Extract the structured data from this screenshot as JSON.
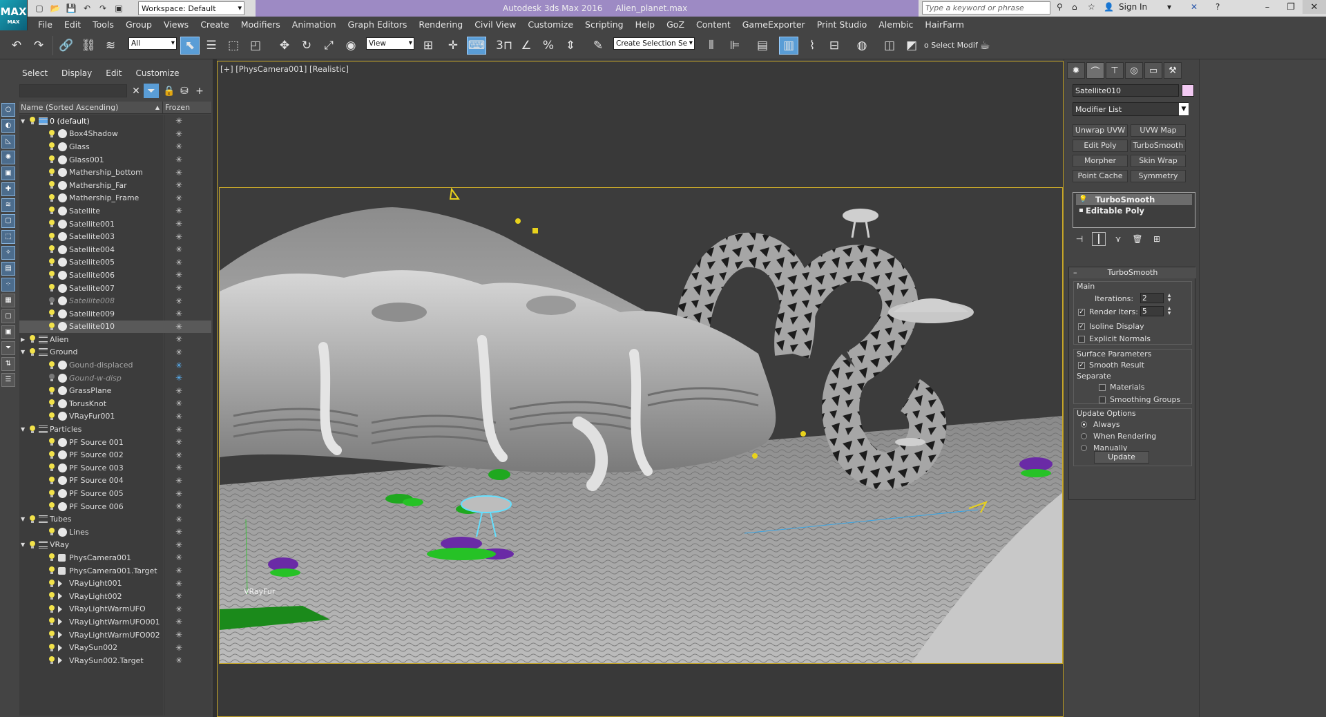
{
  "titlebar": {
    "logo": "MAX",
    "workspace": "Workspace: Default",
    "app_title": "Autodesk 3ds Max 2016     Alien_planet.max",
    "search_placeholder": "Type a keyword or phrase",
    "sign_in": "Sign In"
  },
  "menu": [
    "File",
    "Edit",
    "Tools",
    "Group",
    "Views",
    "Create",
    "Modifiers",
    "Animation",
    "Graph Editors",
    "Rendering",
    "Civil View",
    "Customize",
    "Scripting",
    "Help",
    "GoZ",
    "Content",
    "GameExporter",
    "Print Studio",
    "Alembic",
    "HairFarm"
  ],
  "toolbar": {
    "selection_filter": "All",
    "ref_coord": "View",
    "named_selection": "Create Selection Se",
    "select_modifier": "o Select Modif"
  },
  "explorer": {
    "tabs": [
      "Select",
      "Display",
      "Edit",
      "Customize"
    ],
    "col_name": "Name (Sorted Ascending)",
    "col_frozen": "Frozen",
    "rows": [
      {
        "label": "0 (default)",
        "type": "layer",
        "level": 0,
        "expanded": true,
        "state": "selected-layer"
      },
      {
        "label": "Box4Shadow",
        "type": "object",
        "level": 1
      },
      {
        "label": "Glass",
        "type": "object",
        "level": 1
      },
      {
        "label": "Glass001",
        "type": "object",
        "level": 1
      },
      {
        "label": "Mathership_bottom",
        "type": "object",
        "level": 1
      },
      {
        "label": "Mathership_Far",
        "type": "object",
        "level": 1
      },
      {
        "label": "Mathership_Frame",
        "type": "object",
        "level": 1
      },
      {
        "label": "Satellite",
        "type": "object",
        "level": 1
      },
      {
        "label": "Satellite001",
        "type": "object",
        "level": 1
      },
      {
        "label": "Satellite003",
        "type": "object",
        "level": 1
      },
      {
        "label": "Satellite004",
        "type": "object",
        "level": 1
      },
      {
        "label": "Satellite005",
        "type": "object",
        "level": 1
      },
      {
        "label": "Satellite006",
        "type": "object",
        "level": 1
      },
      {
        "label": "Satellite007",
        "type": "object",
        "level": 1
      },
      {
        "label": "Satellite008",
        "type": "object",
        "level": 1,
        "state": "hidden"
      },
      {
        "label": "Satellite009",
        "type": "object",
        "level": 1
      },
      {
        "label": "Satellite010",
        "type": "object",
        "level": 1,
        "state": "selected"
      },
      {
        "label": "Alien",
        "type": "layer",
        "level": 0,
        "expanded": false
      },
      {
        "label": "Ground",
        "type": "layer",
        "level": 0,
        "expanded": true
      },
      {
        "label": "Gound-displaced",
        "type": "object",
        "level": 1,
        "state": "frozen"
      },
      {
        "label": "Gound-w-disp",
        "type": "object",
        "level": 1,
        "state": "hidden-frozen"
      },
      {
        "label": "GrassPlane",
        "type": "object",
        "level": 1
      },
      {
        "label": "TorusKnot",
        "type": "object",
        "level": 1
      },
      {
        "label": "VRayFur001",
        "type": "object",
        "level": 1
      },
      {
        "label": "Particles",
        "type": "layer",
        "level": 0,
        "expanded": true
      },
      {
        "label": "PF Source 001",
        "type": "object",
        "level": 1
      },
      {
        "label": "PF Source 002",
        "type": "object",
        "level": 1
      },
      {
        "label": "PF Source 003",
        "type": "object",
        "level": 1
      },
      {
        "label": "PF Source 004",
        "type": "object",
        "level": 1
      },
      {
        "label": "PF Source 005",
        "type": "object",
        "level": 1
      },
      {
        "label": "PF Source 006",
        "type": "object",
        "level": 1
      },
      {
        "label": "Tubes",
        "type": "layer",
        "level": 0,
        "expanded": true
      },
      {
        "label": "Lines",
        "type": "shape",
        "level": 1
      },
      {
        "label": "VRay",
        "type": "layer",
        "level": 0,
        "expanded": true
      },
      {
        "label": "PhysCamera001",
        "type": "camera",
        "level": 1
      },
      {
        "label": "PhysCamera001.Target",
        "type": "camera",
        "level": 1
      },
      {
        "label": "VRayLight001",
        "type": "light",
        "level": 1
      },
      {
        "label": "VRayLight002",
        "type": "light",
        "level": 1
      },
      {
        "label": "VRayLightWarmUFO",
        "type": "light",
        "level": 1
      },
      {
        "label": "VRayLightWarmUFO001",
        "type": "light",
        "level": 1
      },
      {
        "label": "VRayLightWarmUFO002",
        "type": "light",
        "level": 1
      },
      {
        "label": "VRaySun002",
        "type": "light",
        "level": 1
      },
      {
        "label": "VRaySun002.Target",
        "type": "light",
        "level": 1
      }
    ]
  },
  "viewport": {
    "label": "[+] [PhysCamera001] [Realistic]",
    "fur_label": "VRayFur"
  },
  "command_panel": {
    "object_name": "Satellite010",
    "object_color": "#f2c9f2",
    "modifier_list": "Modifier List",
    "modifier_buttons": [
      "Unwrap UVW",
      "UVW Map",
      "Edit Poly",
      "TurboSmooth",
      "Morpher",
      "Skin Wrap",
      "Point Cache",
      "Symmetry"
    ],
    "stack": [
      "TurboSmooth",
      "Editable Poly"
    ],
    "turbosmooth": {
      "title": "TurboSmooth",
      "main_label": "Main",
      "iterations_label": "Iterations:",
      "iterations_value": "2",
      "render_iters_label": "Render Iters:",
      "render_iters_value": "5",
      "isoline_display": "Isoline Display",
      "explicit_normals": "Explicit Normals",
      "surface_params": "Surface Parameters",
      "smooth_result": "Smooth Result",
      "separate": "Separate",
      "materials": "Materials",
      "smoothing_groups": "Smoothing Groups",
      "update_options": "Update Options",
      "always": "Always",
      "when_rendering": "When Rendering",
      "manually": "Manually",
      "update_btn": "Update"
    }
  }
}
